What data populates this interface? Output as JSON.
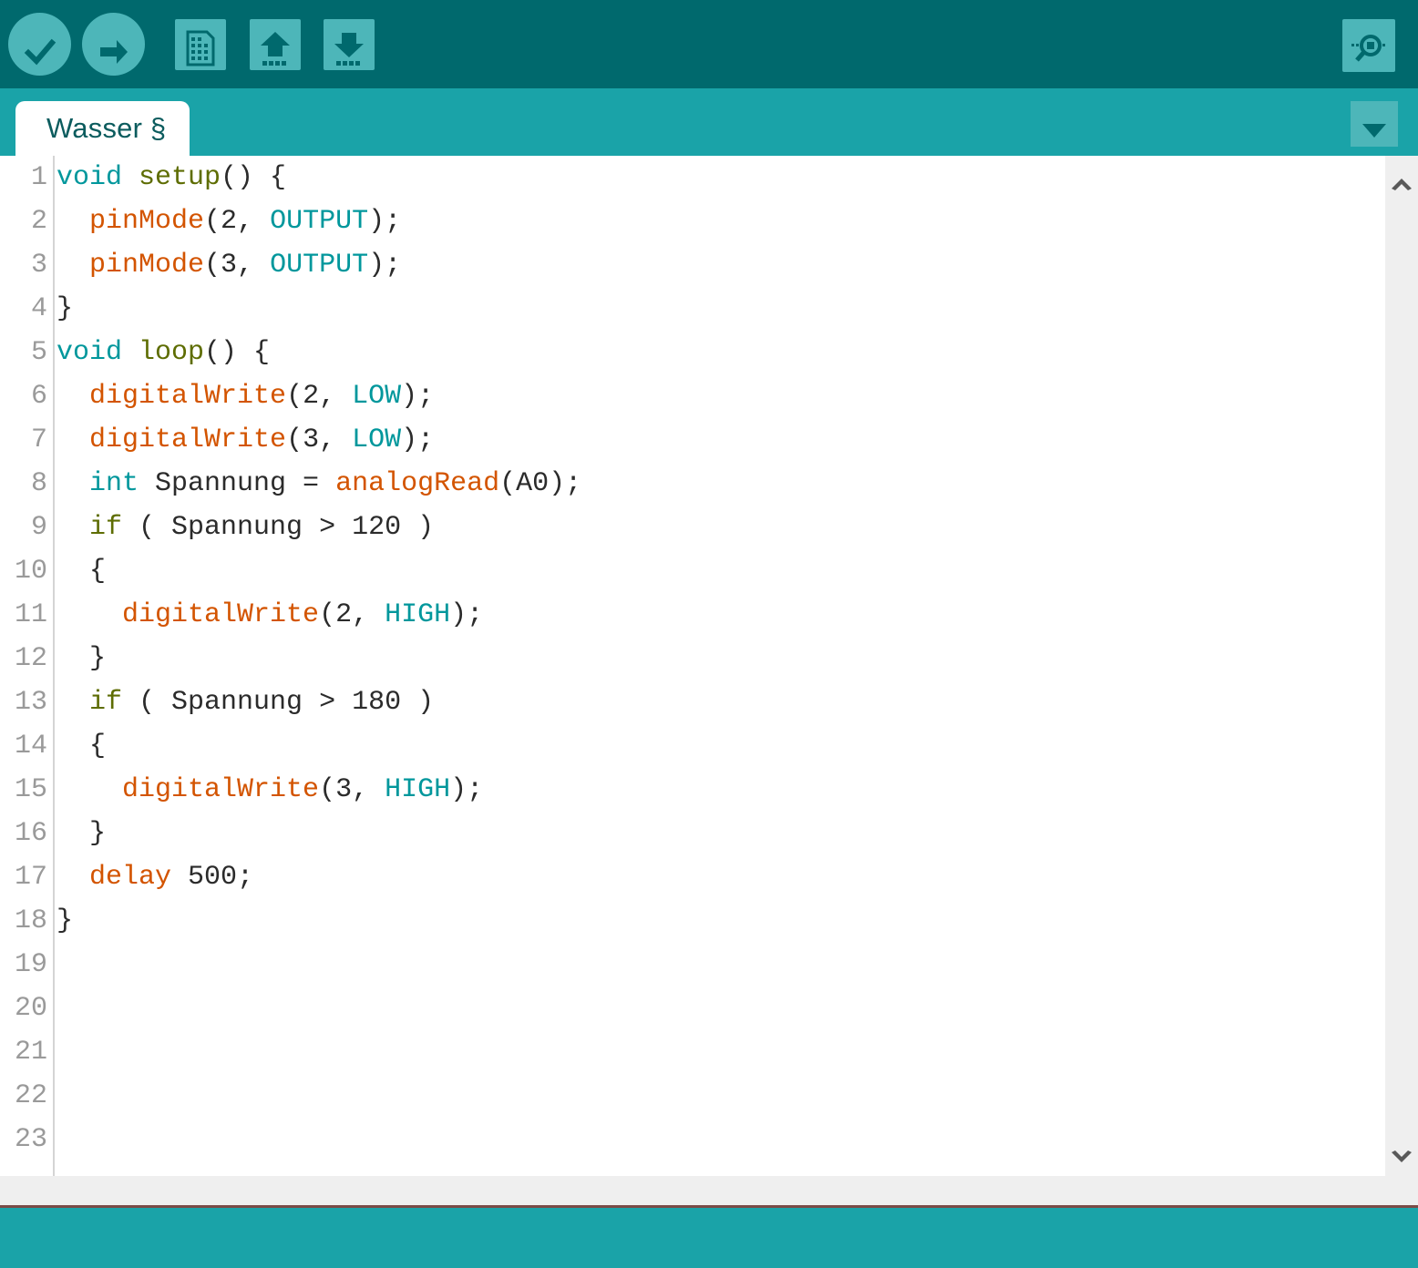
{
  "window": {
    "app": "Arduino IDE",
    "colors": {
      "toolbar_bg": "#00696d",
      "tabbar_bg": "#1aa3a8",
      "icon_fill": "#4db6b9",
      "icon_glyph": "#00696d",
      "editor_bg": "#ffffff",
      "gutter_text": "#9a9a9a",
      "keyword": "#00979c",
      "function_name": "#5e6d03",
      "builtin_function": "#d35400",
      "constant": "#00979c",
      "plain_text": "#2b2b2b",
      "scrollbar_track": "#efefef",
      "scrollbar_arrow": "#595959",
      "status_strip": "#efefef",
      "status_divider": "#7a4b46",
      "console_bg": "#1aa3a8"
    }
  },
  "toolbar": {
    "buttons": [
      {
        "name": "verify",
        "label": "Verify",
        "icon": "check-icon",
        "shape": "circle"
      },
      {
        "name": "upload",
        "label": "Upload",
        "icon": "arrow-right-icon",
        "shape": "circle"
      },
      {
        "name": "new",
        "label": "New",
        "icon": "new-file-icon",
        "shape": "square"
      },
      {
        "name": "open",
        "label": "Open",
        "icon": "arrow-up-icon",
        "shape": "square"
      },
      {
        "name": "save",
        "label": "Save",
        "icon": "arrow-down-icon",
        "shape": "square"
      }
    ],
    "serial_monitor": {
      "name": "serial-monitor",
      "label": "Serial Monitor",
      "icon": "magnifier-icon"
    }
  },
  "tabbar": {
    "tabs": [
      {
        "label": "Wasser §",
        "active": true
      }
    ],
    "menu_button": {
      "label": "",
      "icon": "chevron-down-icon"
    }
  },
  "editor": {
    "line_numbers": [
      "1",
      "2",
      "3",
      "4",
      "5",
      "6",
      "7",
      "8",
      "9",
      "10",
      "11",
      "12",
      "13",
      "14",
      "15",
      "16",
      "17",
      "18",
      "19",
      "20",
      "21",
      "22",
      "23"
    ],
    "lines": [
      {
        "n": "1",
        "tokens": [
          {
            "t": "void",
            "c": "key"
          },
          {
            "t": " ",
            "c": "plain"
          },
          {
            "t": "setup",
            "c": "fn"
          },
          {
            "t": "() {",
            "c": "punc"
          }
        ]
      },
      {
        "n": "2",
        "tokens": [
          {
            "t": "  ",
            "c": "plain"
          },
          {
            "t": "pinMode",
            "c": "func"
          },
          {
            "t": "(2, ",
            "c": "punc"
          },
          {
            "t": "OUTPUT",
            "c": "const"
          },
          {
            "t": ");",
            "c": "punc"
          }
        ]
      },
      {
        "n": "3",
        "tokens": [
          {
            "t": "  ",
            "c": "plain"
          },
          {
            "t": "pinMode",
            "c": "func"
          },
          {
            "t": "(3, ",
            "c": "punc"
          },
          {
            "t": "OUTPUT",
            "c": "const"
          },
          {
            "t": ");",
            "c": "punc"
          }
        ]
      },
      {
        "n": "4",
        "tokens": [
          {
            "t": "}",
            "c": "punc"
          }
        ]
      },
      {
        "n": "5",
        "tokens": [
          {
            "t": "void",
            "c": "key"
          },
          {
            "t": " ",
            "c": "plain"
          },
          {
            "t": "loop",
            "c": "fn"
          },
          {
            "t": "() {",
            "c": "punc"
          }
        ]
      },
      {
        "n": "6",
        "tokens": [
          {
            "t": "  ",
            "c": "plain"
          },
          {
            "t": "digitalWrite",
            "c": "func"
          },
          {
            "t": "(2, ",
            "c": "punc"
          },
          {
            "t": "LOW",
            "c": "const"
          },
          {
            "t": ");",
            "c": "punc"
          }
        ]
      },
      {
        "n": "7",
        "tokens": [
          {
            "t": "  ",
            "c": "plain"
          },
          {
            "t": "digitalWrite",
            "c": "func"
          },
          {
            "t": "(3, ",
            "c": "punc"
          },
          {
            "t": "LOW",
            "c": "const"
          },
          {
            "t": ");",
            "c": "punc"
          }
        ]
      },
      {
        "n": "8",
        "tokens": [
          {
            "t": "  ",
            "c": "plain"
          },
          {
            "t": "int",
            "c": "key"
          },
          {
            "t": " Spannung = ",
            "c": "plain"
          },
          {
            "t": "analogRead",
            "c": "func"
          },
          {
            "t": "(A0);",
            "c": "punc"
          }
        ]
      },
      {
        "n": "9",
        "tokens": [
          {
            "t": "  ",
            "c": "plain"
          },
          {
            "t": "if",
            "c": "fn"
          },
          {
            "t": " ( Spannung > 120 )",
            "c": "plain"
          }
        ]
      },
      {
        "n": "10",
        "tokens": [
          {
            "t": "  {",
            "c": "punc"
          }
        ]
      },
      {
        "n": "11",
        "tokens": [
          {
            "t": "    ",
            "c": "plain"
          },
          {
            "t": "digitalWrite",
            "c": "func"
          },
          {
            "t": "(2, ",
            "c": "punc"
          },
          {
            "t": "HIGH",
            "c": "const"
          },
          {
            "t": ");",
            "c": "punc"
          }
        ]
      },
      {
        "n": "12",
        "tokens": [
          {
            "t": "  }",
            "c": "punc"
          }
        ]
      },
      {
        "n": "13",
        "tokens": [
          {
            "t": "  ",
            "c": "plain"
          },
          {
            "t": "if",
            "c": "fn"
          },
          {
            "t": " ( Spannung > 180 )",
            "c": "plain"
          }
        ]
      },
      {
        "n": "14",
        "tokens": [
          {
            "t": "  {",
            "c": "punc"
          }
        ]
      },
      {
        "n": "15",
        "tokens": [
          {
            "t": "    ",
            "c": "plain"
          },
          {
            "t": "digitalWrite",
            "c": "func"
          },
          {
            "t": "(3, ",
            "c": "punc"
          },
          {
            "t": "HIGH",
            "c": "const"
          },
          {
            "t": ");",
            "c": "punc"
          }
        ]
      },
      {
        "n": "16",
        "tokens": [
          {
            "t": "  }",
            "c": "punc"
          }
        ]
      },
      {
        "n": "17",
        "tokens": [
          {
            "t": "  ",
            "c": "plain"
          },
          {
            "t": "delay",
            "c": "func"
          },
          {
            "t": " 500;",
            "c": "plain"
          }
        ]
      },
      {
        "n": "18",
        "tokens": [
          {
            "t": "}",
            "c": "punc"
          }
        ]
      },
      {
        "n": "19",
        "tokens": []
      },
      {
        "n": "20",
        "tokens": []
      },
      {
        "n": "21",
        "tokens": []
      },
      {
        "n": "22",
        "tokens": []
      },
      {
        "n": "23",
        "tokens": []
      }
    ],
    "source_text": "void setup() {\n  pinMode(2, OUTPUT);\n  pinMode(3, OUTPUT);\n}\nvoid loop() {\n  digitalWrite(2, LOW);\n  digitalWrite(3, LOW);\n  int Spannung = analogRead(A0);\n  if ( Spannung > 120 )\n  {\n    digitalWrite(2, HIGH);\n  }\n  if ( Spannung > 180 )\n  {\n    digitalWrite(3, HIGH);\n  }\n  delay 500;\n}"
  },
  "scrollbar": {
    "up_arrow": {
      "icon": "chevron-up-icon"
    },
    "down_arrow": {
      "icon": "chevron-down-icon"
    }
  },
  "console": {
    "text": ""
  },
  "statusbar": {
    "text": ""
  }
}
